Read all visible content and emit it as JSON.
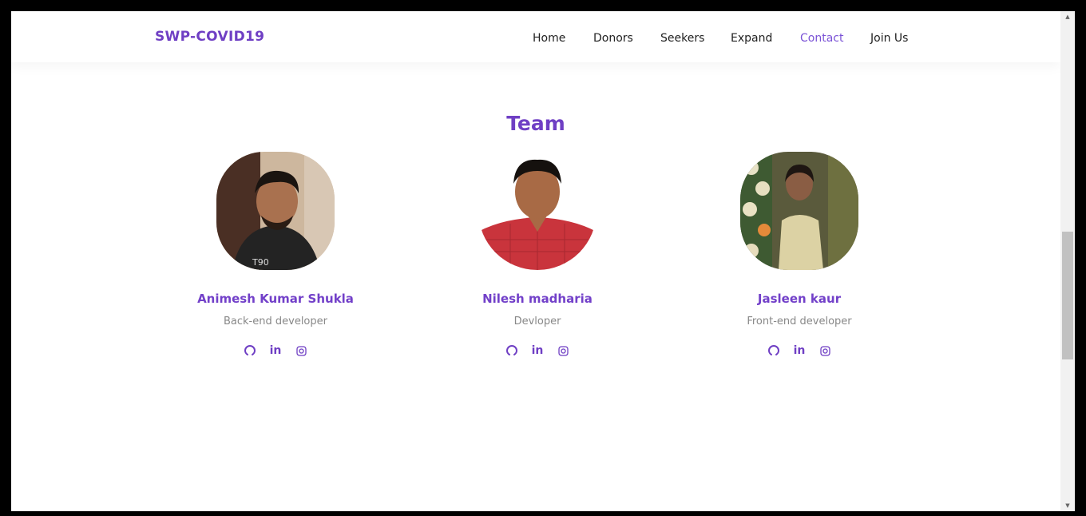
{
  "header": {
    "brand": "SWP-COVID19",
    "nav": [
      {
        "label": "Home",
        "active": false
      },
      {
        "label": "Donors",
        "active": false
      },
      {
        "label": "Seekers",
        "active": false
      },
      {
        "label": "Expand",
        "active": false
      },
      {
        "label": "Contact",
        "active": true
      },
      {
        "label": "Join Us",
        "active": false
      }
    ]
  },
  "team": {
    "title": "Team",
    "members": [
      {
        "name": "Animesh Kumar Shukla",
        "role": "Back-end developer",
        "socials": [
          "github-icon",
          "linkedin-icon",
          "instagram-icon"
        ]
      },
      {
        "name": "Nilesh madharia",
        "role": "Devloper",
        "socials": [
          "github-icon",
          "linkedin-icon",
          "instagram-icon"
        ]
      },
      {
        "name": "Jasleen kaur",
        "role": "Front-end developer",
        "socials": [
          "github-icon",
          "linkedin-icon",
          "instagram-icon"
        ]
      }
    ]
  },
  "icons": {
    "linkedin_text": "in"
  },
  "colors": {
    "accent": "#6f3fc4",
    "nav_active": "#7a52d6",
    "text": "#222222",
    "muted": "#888888"
  }
}
